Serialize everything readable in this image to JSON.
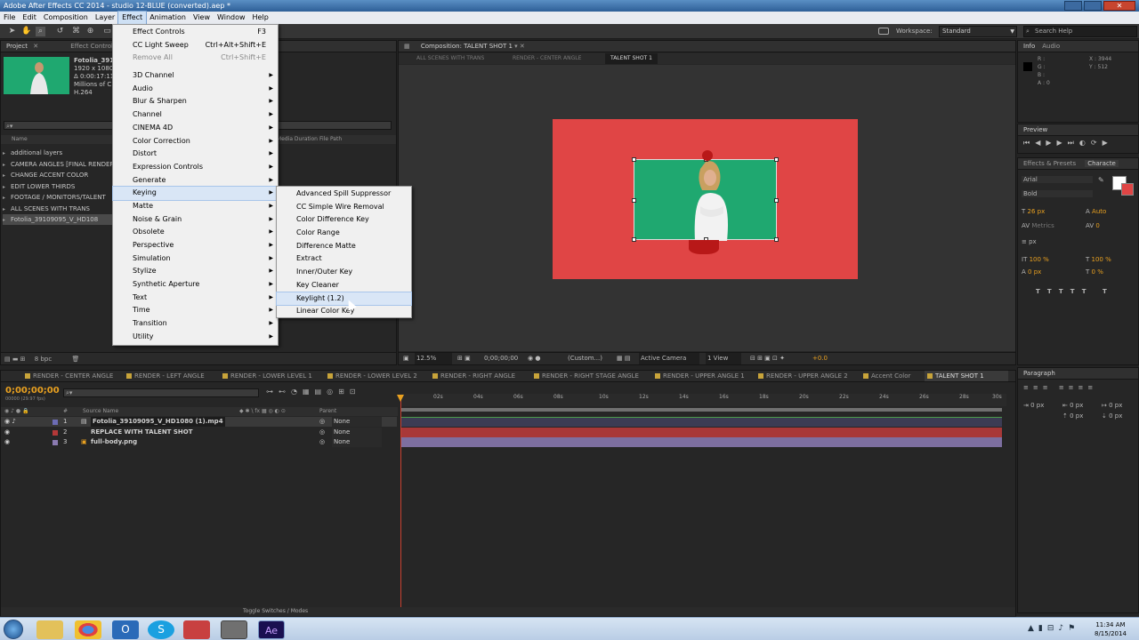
{
  "window": {
    "title": "Adobe After Effects CC 2014 - studio 12-BLUE (converted).aep *"
  },
  "menubar": [
    "File",
    "Edit",
    "Composition",
    "Layer",
    "Effect",
    "Animation",
    "View",
    "Window",
    "Help"
  ],
  "toolbar": {
    "workspace_label": "Workspace:",
    "workspace_value": "Standard",
    "search_placeholder": "Search Help"
  },
  "project": {
    "tab1": "Project",
    "tab2": "Effect Controls",
    "file": {
      "name": "Fotolia_3910",
      "res": "1920 x 1080",
      "dur": "Δ 0:00:17:11",
      "desc": "Millions of C",
      "codec": "H.264"
    },
    "col_name": "Name",
    "col_duration": "Media Duration",
    "col_path": "File Path",
    "items": [
      "additional layers",
      "CAMERA ANGLES [FINAL RENDER",
      "CHANGE ACCENT COLOR",
      "EDIT LOWER THIRDS",
      "FOOTAGE / MONITORS/TALENT",
      "ALL SCENES WITH TRANS",
      "Fotolia_39109095_V_HD108"
    ],
    "bpc": "8 bpc"
  },
  "effect_menu": [
    {
      "label": "Effect Controls",
      "shortcut": "F3"
    },
    {
      "label": "CC Light Sweep",
      "shortcut": "Ctrl+Alt+Shift+E"
    },
    {
      "label": "Remove All",
      "shortcut": "Ctrl+Shift+E",
      "disabled": true
    },
    {
      "sep": true
    },
    {
      "label": "3D Channel",
      "sub": true
    },
    {
      "label": "Audio",
      "sub": true
    },
    {
      "label": "Blur & Sharpen",
      "sub": true
    },
    {
      "label": "Channel",
      "sub": true
    },
    {
      "label": "CINEMA 4D",
      "sub": true
    },
    {
      "label": "Color Correction",
      "sub": true
    },
    {
      "label": "Distort",
      "sub": true
    },
    {
      "label": "Expression Controls",
      "sub": true
    },
    {
      "label": "Generate",
      "sub": true
    },
    {
      "label": "Keying",
      "sub": true,
      "active": true
    },
    {
      "label": "Matte",
      "sub": true
    },
    {
      "label": "Noise & Grain",
      "sub": true
    },
    {
      "label": "Obsolete",
      "sub": true
    },
    {
      "label": "Perspective",
      "sub": true
    },
    {
      "label": "Simulation",
      "sub": true
    },
    {
      "label": "Stylize",
      "sub": true
    },
    {
      "label": "Synthetic Aperture",
      "sub": true
    },
    {
      "label": "Text",
      "sub": true
    },
    {
      "label": "Time",
      "sub": true
    },
    {
      "label": "Transition",
      "sub": true
    },
    {
      "label": "Utility",
      "sub": true
    }
  ],
  "keying_menu": [
    "Advanced Spill Suppressor",
    "CC Simple Wire Removal",
    "Color Difference Key",
    "Color Range",
    "Difference Matte",
    "Extract",
    "Inner/Outer Key",
    "Key Cleaner",
    "Keylight (1.2)",
    "Linear Color Key"
  ],
  "keying_highlight": "Keylight (1.2)",
  "composition": {
    "tab": "Composition: TALENT SHOT 1",
    "breadcrumbs": [
      "ALL SCENES WITH TRANS",
      "RENDER - CENTER ANGLE",
      "TALENT SHOT 1"
    ],
    "zoom": "12.5%",
    "timecode": "0;00;00;00",
    "resolution": "(Custom...)",
    "camera": "Active Camera",
    "views": "1 View",
    "exposure": "+0.0"
  },
  "info": {
    "tab1": "Info",
    "tab2": "Audio",
    "r": "R :",
    "g": "G :",
    "b": "B :",
    "a": "A : 0",
    "x": "X : 3944",
    "y": "Y : 512"
  },
  "preview": {
    "tab": "Preview"
  },
  "effects_presets": {
    "tab1": "Effects & Presets",
    "tab2": "Characte"
  },
  "character": {
    "font": "Arial",
    "style": "Bold",
    "size": "26 px",
    "leading": "Auto",
    "tracking": "0",
    "vscale": "100 %",
    "hscale": "100 %",
    "baseline": "0 px",
    "tsume": "0 %",
    "px_label": "px",
    "metrics": "Metrics"
  },
  "paragraph": {
    "tab": "Paragraph",
    "indent1": "0 px",
    "indent2": "0 px",
    "indent3": "0 px",
    "space1": "0 px",
    "space2": "0 px"
  },
  "timeline": {
    "tabs": [
      "RENDER - CENTER ANGLE",
      "RENDER - LEFT ANGLE",
      "RENDER - LOWER LEVEL 1",
      "RENDER - LOWER LEVEL 2",
      "RENDER - RIGHT ANGLE",
      "RENDER - RIGHT STAGE ANGLE",
      "RENDER - UPPER ANGLE 1",
      "RENDER - UPPER ANGLE 2",
      "Accent Color",
      "TALENT SHOT 1"
    ],
    "timecode": "0;00;00;00",
    "fps": "00000 (29.97 fps)",
    "col_num": "#",
    "col_source": "Source Name",
    "col_parent": "Parent",
    "layers": [
      {
        "num": "1",
        "name": "Fotolia_39109095_V_HD1080 (1).mp4",
        "parent": "None",
        "color": "#6c6cb4"
      },
      {
        "num": "2",
        "name": "REPLACE WITH TALENT SHOT",
        "parent": "None",
        "color": "#b43838"
      },
      {
        "num": "3",
        "name": "full-body.png",
        "parent": "None",
        "color": "#8a7ab0"
      }
    ],
    "ruler": [
      "0s",
      "02s",
      "04s",
      "06s",
      "08s",
      "10s",
      "12s",
      "14s",
      "16s",
      "18s",
      "20s",
      "22s",
      "24s",
      "26s",
      "28s",
      "30s"
    ],
    "toggle": "Toggle Switches / Modes"
  },
  "clock": {
    "time": "11:34 AM",
    "date": "8/15/2014"
  },
  "colors": {
    "comp_bg": "#e04545",
    "green": "#1fa870",
    "accent": "#e8a020"
  }
}
